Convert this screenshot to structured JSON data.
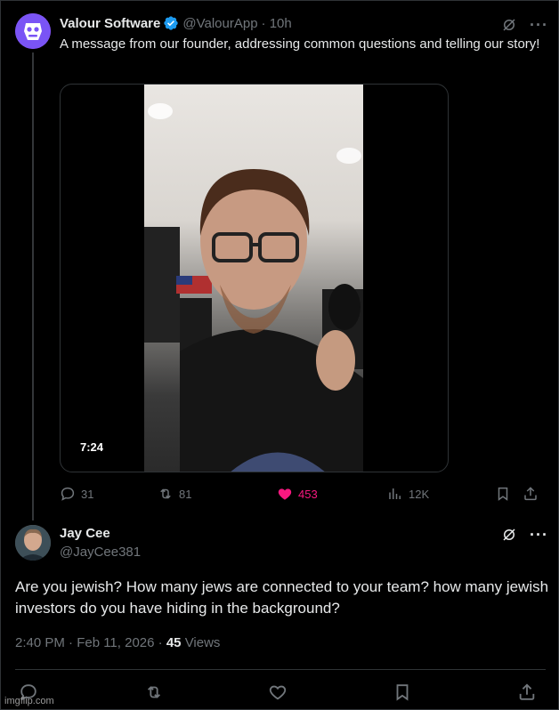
{
  "tweet": {
    "author_name": "Valour Software",
    "author_handle": "@ValourApp",
    "time": "· 10h",
    "text": "A message from our founder, addressing common questions and telling our story!",
    "video_duration": "7:24",
    "stats": {
      "replies": "31",
      "reposts": "81",
      "likes": "453",
      "views": "12K"
    },
    "icons": {
      "avatar": "valour-logo-icon",
      "verified": "verified-badge-icon",
      "grok": "grok-icon",
      "more": "more-icon",
      "reply": "reply-icon",
      "repost": "repost-icon",
      "like": "heart-filled-icon",
      "views": "analytics-icon",
      "bookmark": "bookmark-icon",
      "share": "share-icon"
    },
    "colors": {
      "like": "#f91880",
      "verified": "#1d9bf0",
      "secondary_text": "#71767b"
    }
  },
  "reply": {
    "author_name": "Jay Cee",
    "author_handle": "@JayCee381",
    "text": "Are you jewish? How many jews are connected to your team? how many jewish investors do you have hiding in the background?",
    "time": "2:40 PM · Feb 11, 2026 ·",
    "views_count": "45",
    "views_label": "Views",
    "icons": {
      "avatar": "avatar",
      "grok": "grok-icon",
      "more": "more-icon",
      "reply": "reply-icon",
      "repost": "repost-icon",
      "like": "heart-icon",
      "bookmark": "bookmark-icon",
      "share": "share-icon"
    }
  },
  "watermark": "imgflip.com"
}
